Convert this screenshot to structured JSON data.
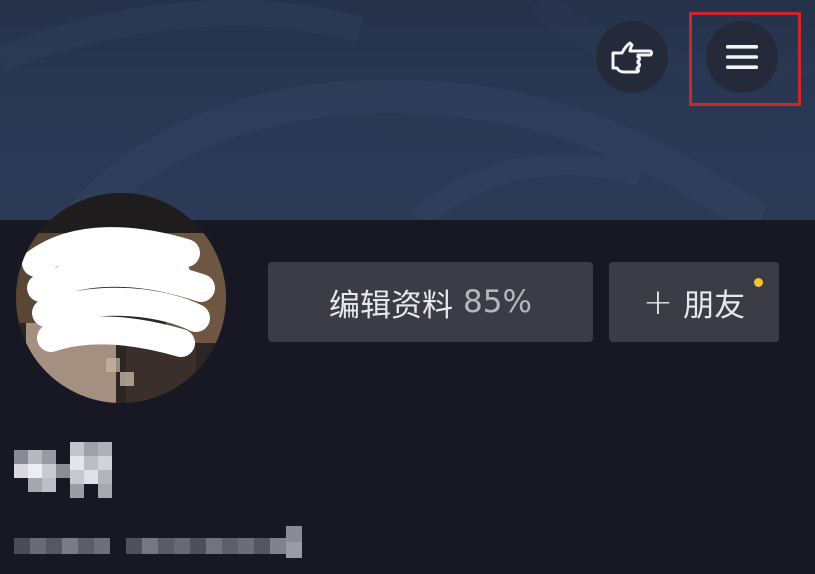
{
  "header": {
    "hand_icon": "pointing-hand-icon",
    "menu_icon": "hamburger-menu-icon",
    "highlight_color": "#d0262a"
  },
  "profile": {
    "edit_profile_label": "编辑资料",
    "edit_profile_percent": "85%",
    "add_friend_plus": "+",
    "add_friend_label": "朋友",
    "notification_dot_color": "#f2c230"
  }
}
